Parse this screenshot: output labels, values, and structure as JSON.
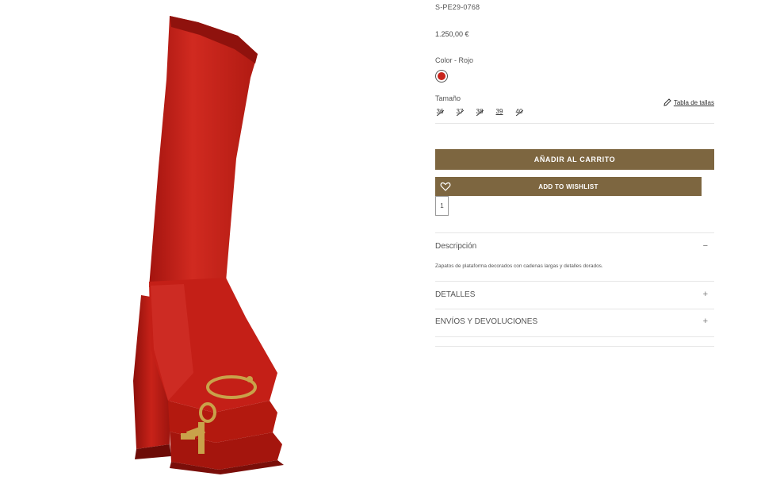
{
  "product": {
    "sku": "S-PE29-0768",
    "price": "1.250,00 €",
    "color_label": "Color - Rojo",
    "color_hex": "#c8241c",
    "size_label": "Tamaño",
    "size_guide": "Tabla de tallas",
    "sizes": [
      {
        "label": "36",
        "available": false
      },
      {
        "label": "37",
        "available": false
      },
      {
        "label": "38",
        "available": false
      },
      {
        "label": "39",
        "available": true
      },
      {
        "label": "40",
        "available": false
      }
    ],
    "quantity": "1"
  },
  "actions": {
    "add_to_cart": "AÑADIR AL CARRITO",
    "add_to_wishlist": "ADD TO WISHLIST"
  },
  "accordion": {
    "description_title": "Descripción",
    "description_sign": "−",
    "description_text": "Zapatos de plataforma decorados con cadenas largas y detalles dorados.",
    "details_title": "DETALLES",
    "details_sign": "+",
    "shipping_title": "ENVÍOS Y DEVOLUCIONES",
    "shipping_sign": "+"
  },
  "colors": {
    "accent": "#7d6640",
    "boot_red": "#c8241c"
  }
}
